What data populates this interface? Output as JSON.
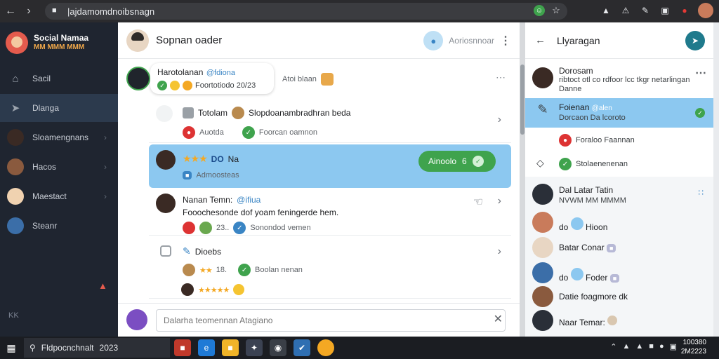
{
  "browser": {
    "url": "|ajdamomdnoibsnagn",
    "back_icon": "arrow-left-icon",
    "forward_icon": "arrow-right-icon"
  },
  "sidebar": {
    "title": "Social Namaa",
    "subtitle": "MM MMM MMM",
    "items": [
      {
        "label": "Sacil",
        "icon": "home-icon"
      },
      {
        "label": "Dlanga",
        "icon": "navigate-icon"
      },
      {
        "label": "Sloamengnans",
        "icon": "person-avatar"
      },
      {
        "label": "Hacos",
        "icon": "person-avatar"
      },
      {
        "label": "Maestact",
        "icon": "person-avatar"
      },
      {
        "label": "Steanr",
        "icon": "person-avatar"
      }
    ],
    "footer": "KK"
  },
  "main": {
    "title": "Sopnan oader",
    "header_action": "Aoriosnnoar",
    "post": {
      "name": "Harotolanan",
      "handle": "@fdiona",
      "date": "Foortotiodo 20/23",
      "reaction_label": "Atoi blaan"
    },
    "cards": [
      {
        "title": "Totolam",
        "text": "Slopdoanambradhran beda",
        "meta": "Auotda",
        "meta2": "Foorcan oamnon"
      },
      {
        "title": "DO",
        "text": "Na",
        "meta": "Admoosteas",
        "pill": "Ainoolo",
        "pill_count": "6"
      },
      {
        "name": "Nanan Temn:",
        "handle": "@ifiua",
        "text": "Fooochesonde dof yoam feningerde hem.",
        "count": "23..",
        "meta": "Sonondod vemen"
      },
      {
        "title": "Dioebs",
        "count": "18.",
        "meta": "Boolan nenan"
      }
    ],
    "composer_placeholder": "Dalarha teomennan Atagiano"
  },
  "right": {
    "title": "Llyaragan",
    "items": [
      {
        "name": "Dorosam",
        "sub": "ribtoct otl co rdfoor lcc tkgr netarlingan Danne"
      },
      {
        "name": "Foienan",
        "handle": "@alen",
        "sub": "Dorcaon Da lcoroto",
        "selected": true
      },
      {
        "name": "",
        "sub": "Foraloo Faannan"
      },
      {
        "name": "",
        "sub": "Stolaenenenan"
      },
      {
        "name": "Dal Latar Tatin",
        "sub": "NVWM MM MMMM"
      },
      {
        "name": "",
        "prefix": "do",
        "sub": "Hioon"
      },
      {
        "name": "Batar Conar",
        "sub": ""
      },
      {
        "name": "",
        "prefix": "do",
        "sub": "Foder"
      },
      {
        "name": "Datie foagmore dk",
        "sub": ""
      },
      {
        "name": "Naar Temar:",
        "sub": ""
      }
    ]
  },
  "taskbar": {
    "search": "Fldpocnchnalt",
    "search_suffix": "2023",
    "time": "100380",
    "date": "2M2223"
  }
}
